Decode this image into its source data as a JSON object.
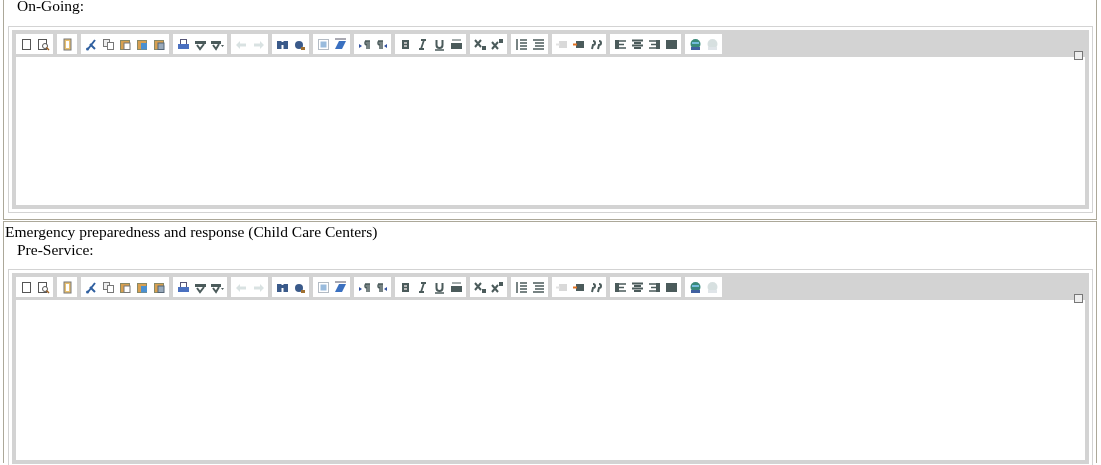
{
  "sections": [
    {
      "label": "On-Going:",
      "editor": {
        "toolbar": [
          [
            {
              "kind": "new-page",
              "disabled": false
            },
            {
              "kind": "preview",
              "disabled": false
            }
          ],
          [
            {
              "kind": "templates",
              "disabled": false
            }
          ],
          [
            {
              "kind": "cut",
              "disabled": false
            },
            {
              "kind": "copy",
              "disabled": false
            },
            {
              "kind": "paste",
              "disabled": false
            },
            {
              "kind": "paste-text",
              "disabled": false
            },
            {
              "kind": "paste-word",
              "disabled": false
            }
          ],
          [
            {
              "kind": "print",
              "disabled": false
            },
            {
              "kind": "spellcheck",
              "disabled": false
            },
            {
              "kind": "spellcheck-menu",
              "disabled": false
            }
          ],
          [
            {
              "kind": "undo",
              "disabled": true
            },
            {
              "kind": "redo",
              "disabled": true
            }
          ],
          [
            {
              "kind": "find",
              "disabled": false
            },
            {
              "kind": "replace",
              "disabled": false
            }
          ],
          [
            {
              "kind": "select-all",
              "disabled": false
            },
            {
              "kind": "remove-format",
              "disabled": false
            }
          ],
          [
            {
              "kind": "ltr",
              "disabled": false
            },
            {
              "kind": "rtl",
              "disabled": false
            }
          ],
          [
            {
              "kind": "bold",
              "disabled": false
            },
            {
              "kind": "italic",
              "disabled": false
            },
            {
              "kind": "underline",
              "disabled": false
            },
            {
              "kind": "strike",
              "disabled": false
            }
          ],
          [
            {
              "kind": "subscript",
              "disabled": false
            },
            {
              "kind": "superscript",
              "disabled": false
            }
          ],
          [
            {
              "kind": "ordered-list",
              "disabled": false
            },
            {
              "kind": "bullet-list",
              "disabled": false
            }
          ],
          [
            {
              "kind": "outdent",
              "disabled": true
            },
            {
              "kind": "indent",
              "disabled": false
            },
            {
              "kind": "blockquote",
              "disabled": false
            }
          ],
          [
            {
              "kind": "align-left",
              "disabled": false
            },
            {
              "kind": "align-center",
              "disabled": false
            },
            {
              "kind": "align-right",
              "disabled": false
            },
            {
              "kind": "justify",
              "disabled": false
            }
          ],
          [
            {
              "kind": "link",
              "disabled": false
            },
            {
              "kind": "unlink",
              "disabled": true
            }
          ]
        ]
      }
    },
    {
      "title": "Emergency preparedness and response (Child Care Centers)",
      "label": "Pre-Service:",
      "editor": {
        "toolbar": [
          [
            {
              "kind": "new-page",
              "disabled": false
            },
            {
              "kind": "preview",
              "disabled": false
            }
          ],
          [
            {
              "kind": "templates",
              "disabled": false
            }
          ],
          [
            {
              "kind": "cut",
              "disabled": false
            },
            {
              "kind": "copy",
              "disabled": false
            },
            {
              "kind": "paste",
              "disabled": false
            },
            {
              "kind": "paste-text",
              "disabled": false
            },
            {
              "kind": "paste-word",
              "disabled": false
            }
          ],
          [
            {
              "kind": "print",
              "disabled": false
            },
            {
              "kind": "spellcheck",
              "disabled": false
            },
            {
              "kind": "spellcheck-menu",
              "disabled": false
            }
          ],
          [
            {
              "kind": "undo",
              "disabled": true
            },
            {
              "kind": "redo",
              "disabled": true
            }
          ],
          [
            {
              "kind": "find",
              "disabled": false
            },
            {
              "kind": "replace",
              "disabled": false
            }
          ],
          [
            {
              "kind": "select-all",
              "disabled": false
            },
            {
              "kind": "remove-format",
              "disabled": false
            }
          ],
          [
            {
              "kind": "ltr",
              "disabled": false
            },
            {
              "kind": "rtl",
              "disabled": false
            }
          ],
          [
            {
              "kind": "bold",
              "disabled": false
            },
            {
              "kind": "italic",
              "disabled": false
            },
            {
              "kind": "underline",
              "disabled": false
            },
            {
              "kind": "strike",
              "disabled": false
            }
          ],
          [
            {
              "kind": "subscript",
              "disabled": false
            },
            {
              "kind": "superscript",
              "disabled": false
            }
          ],
          [
            {
              "kind": "ordered-list",
              "disabled": false
            },
            {
              "kind": "bullet-list",
              "disabled": false
            }
          ],
          [
            {
              "kind": "outdent",
              "disabled": true
            },
            {
              "kind": "indent",
              "disabled": false
            },
            {
              "kind": "blockquote",
              "disabled": false
            }
          ],
          [
            {
              "kind": "align-left",
              "disabled": false
            },
            {
              "kind": "align-center",
              "disabled": false
            },
            {
              "kind": "align-right",
              "disabled": false
            },
            {
              "kind": "justify",
              "disabled": false
            }
          ],
          [
            {
              "kind": "link",
              "disabled": false
            },
            {
              "kind": "unlink",
              "disabled": true
            }
          ]
        ]
      }
    }
  ]
}
